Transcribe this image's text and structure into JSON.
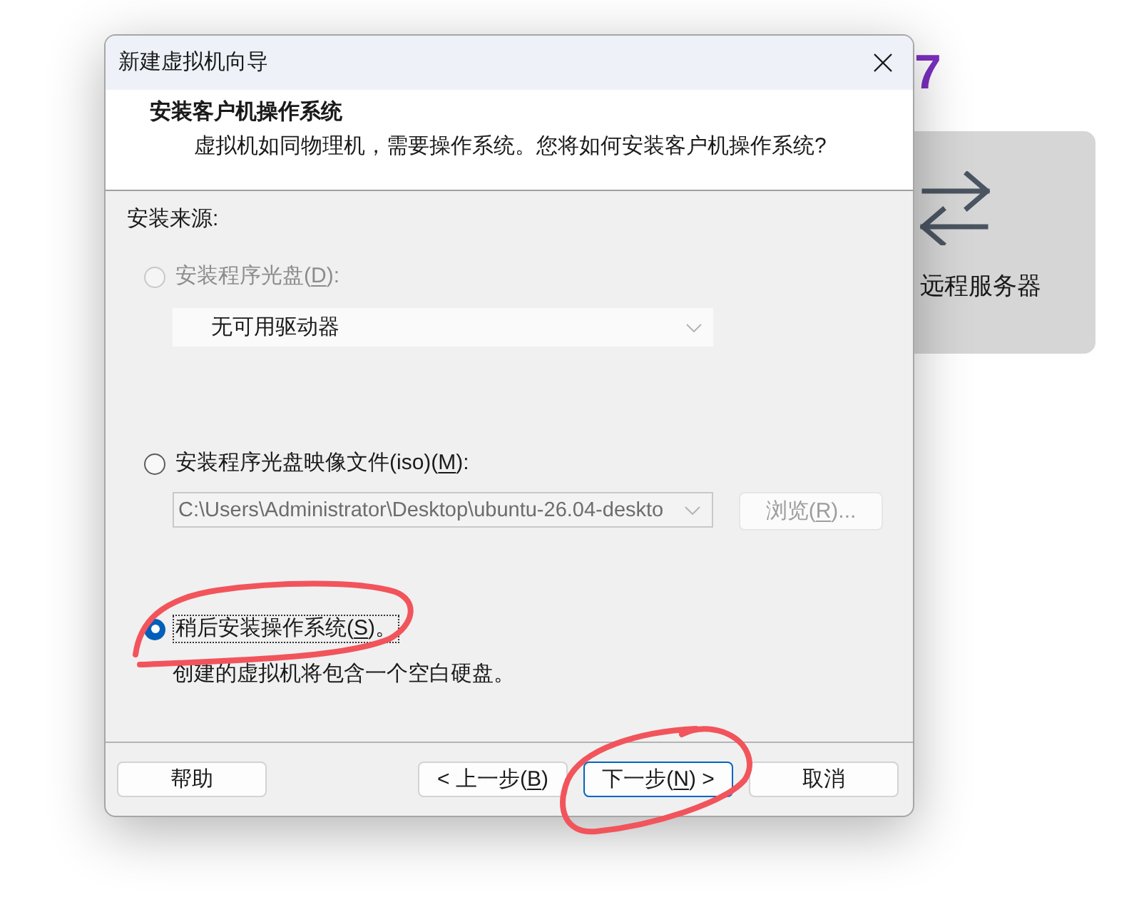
{
  "background_app": {
    "heading_tail": "7",
    "card": {
      "label": "远程服务器"
    }
  },
  "window": {
    "title": "新建虚拟机向导"
  },
  "header": {
    "title": "安装客户机操作系统",
    "subtitle": "虚拟机如同物理机，需要操作系统。您将如何安装客户机操作系统?"
  },
  "source": {
    "label": "安装来源:",
    "options": [
      {
        "kind": "drive",
        "label": "安装程序光盘(D):",
        "access_key_underlined": true,
        "selected": false,
        "disabled": true,
        "focused": false,
        "circled": false,
        "dropdown": {
          "value": "无可用驱动器",
          "disabled": true
        }
      },
      {
        "kind": "iso",
        "label": "安装程序光盘映像文件(iso)(M):",
        "access_key_underlined": true,
        "selected": false,
        "disabled": false,
        "focused": false,
        "circled": false,
        "combo": {
          "value": "C:\\Users\\Administrator\\Desktop\\ubuntu-26.04-deskto",
          "disabled": true
        },
        "browse_button": {
          "label": "浏览(R)...",
          "access_key_underlined": true,
          "disabled": true
        }
      },
      {
        "kind": "later",
        "label": "稍后安装操作系统(S)。",
        "access_key_underlined": true,
        "selected": true,
        "disabled": false,
        "focused": true,
        "circled": true,
        "description": "创建的虚拟机将包含一个空白硬盘。"
      }
    ]
  },
  "buttons": [
    {
      "label": "帮助",
      "default": false,
      "circled": false
    },
    {
      "label": "< 上一步(B)",
      "access_key_underlined": true,
      "default": false,
      "circled": false
    },
    {
      "label": "下一步(N) >",
      "access_key_underlined": true,
      "default": true,
      "circled": true
    },
    {
      "label": "取消",
      "default": false,
      "circled": false
    }
  ]
}
